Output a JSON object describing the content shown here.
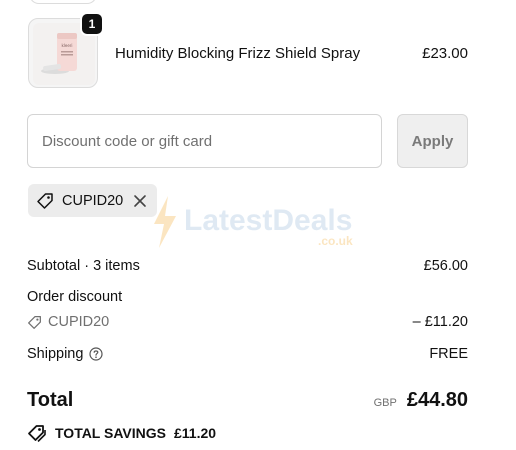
{
  "product": {
    "quantity": "1",
    "name": "Humidity Blocking Frizz Shield Spray",
    "price": "£23.00",
    "image_alt": "product-bottle"
  },
  "discount": {
    "placeholder": "Discount code or gift card",
    "value": "",
    "apply_label": "Apply",
    "applied_code": "CUPID20"
  },
  "watermark": {
    "text": "LatestDeals",
    "sub": ".co.uk"
  },
  "summary": {
    "subtotal_label": "Subtotal · 3 items",
    "subtotal_value": "£56.00",
    "order_discount_label": "Order discount",
    "discount_code": "CUPID20",
    "discount_value": "– £11.20",
    "shipping_label": "Shipping",
    "shipping_value": "FREE",
    "total_label": "Total",
    "currency": "GBP",
    "total_value": "£44.80",
    "savings_label": "TOTAL SAVINGS",
    "savings_value": "£11.20"
  },
  "colors": {
    "badge": "#111111",
    "pill_bg": "#ececec",
    "apply_bg": "#efefef"
  }
}
